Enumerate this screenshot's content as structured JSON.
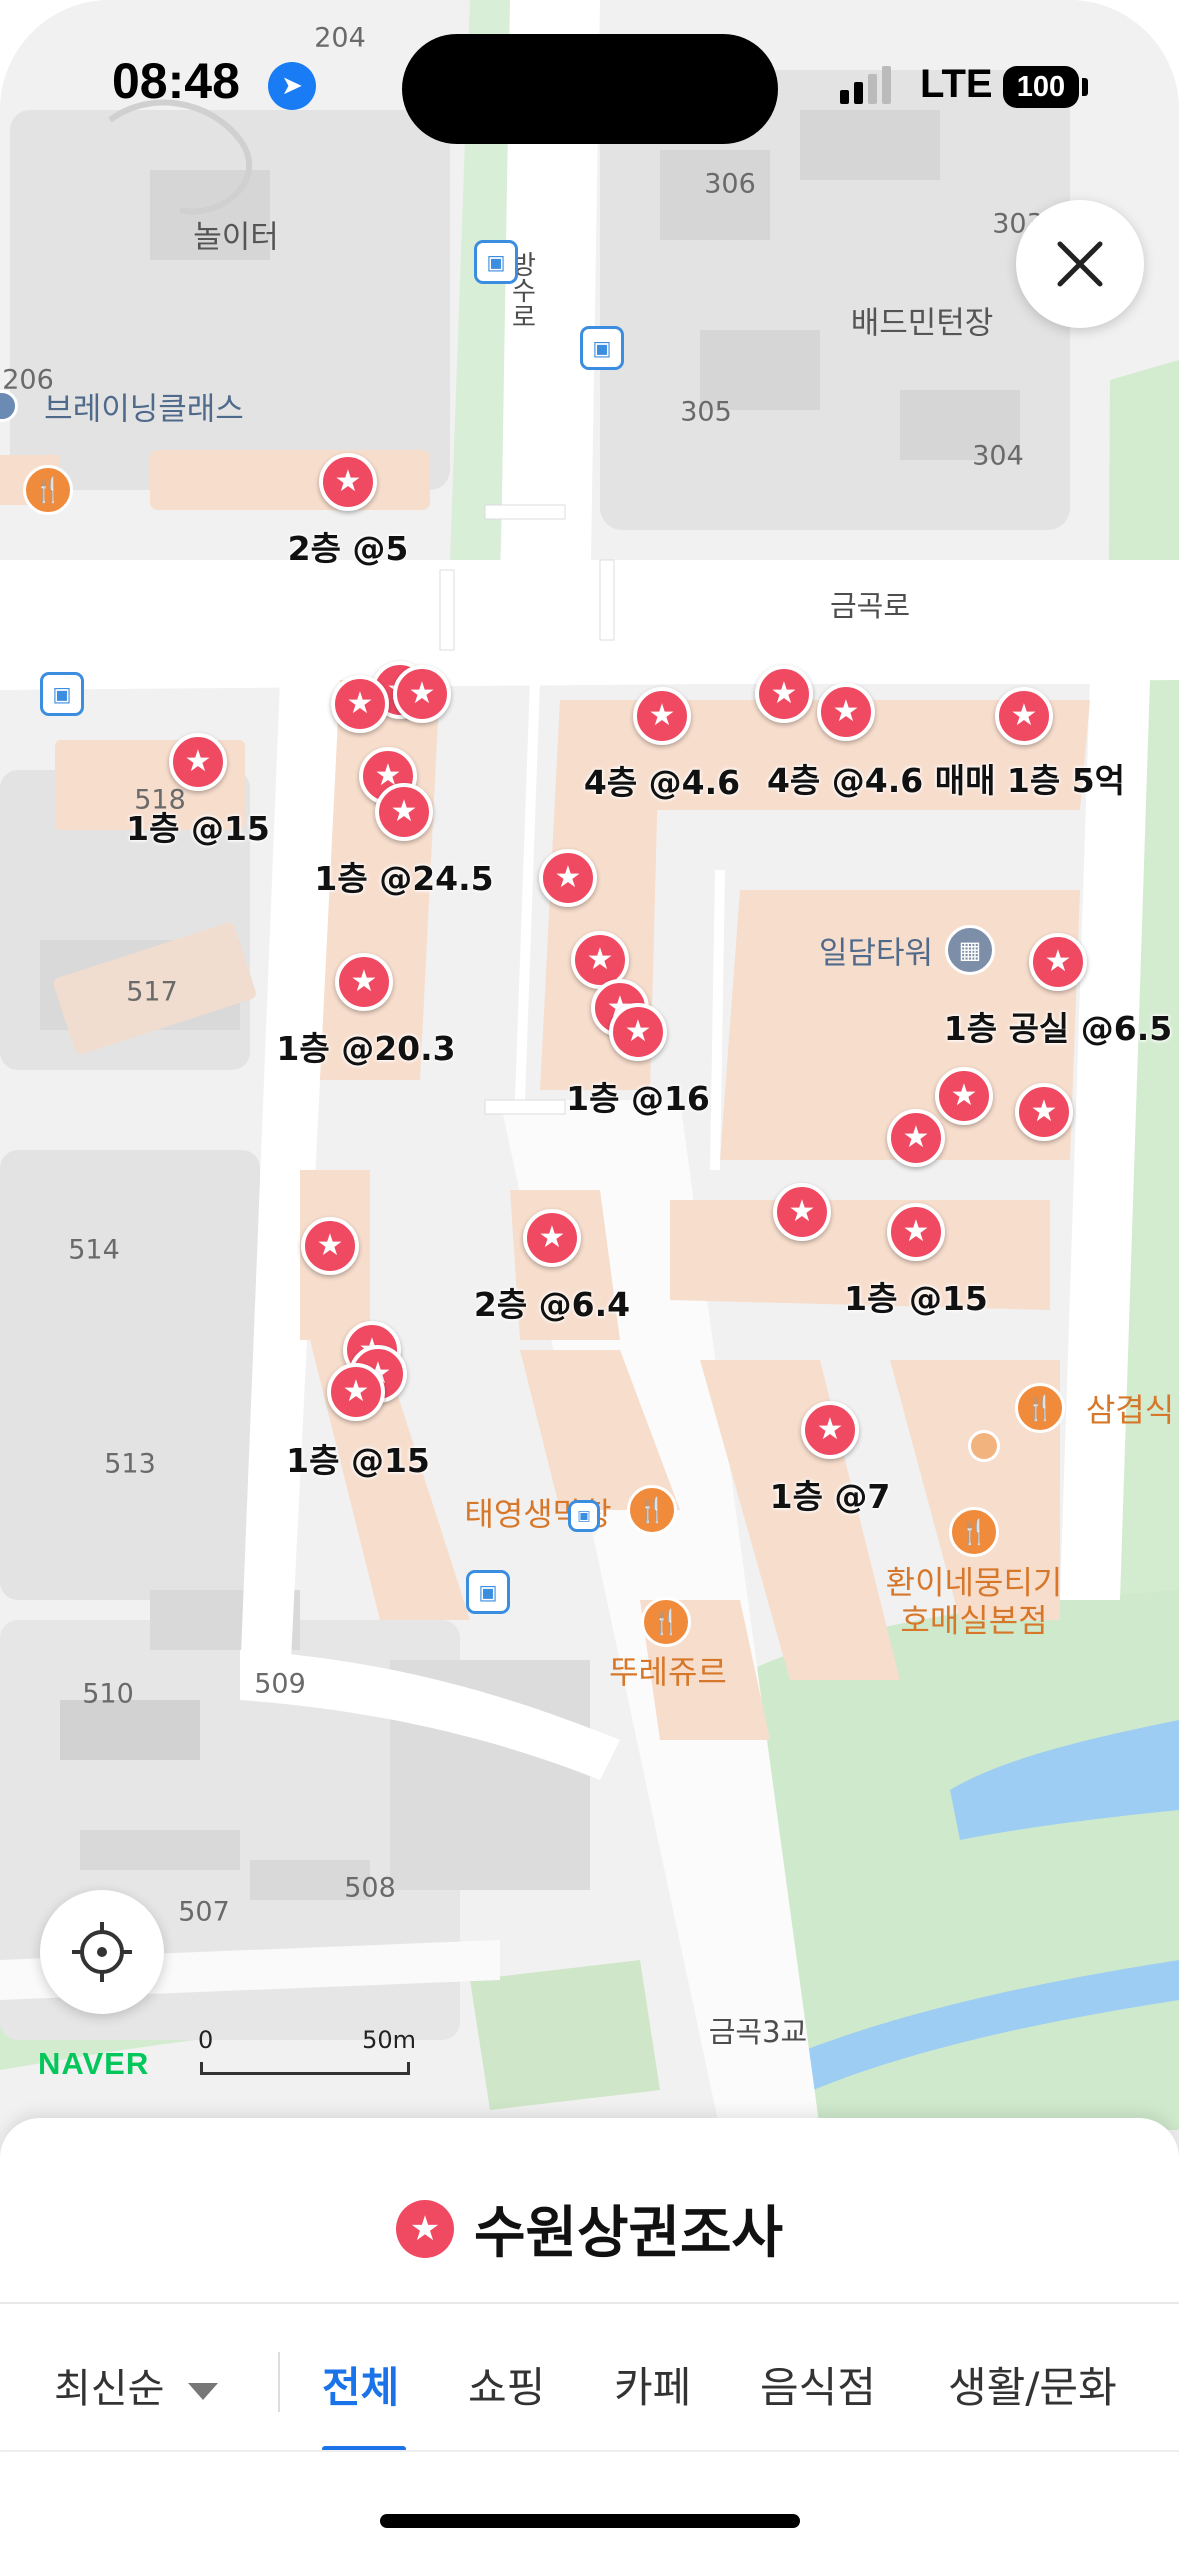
{
  "status_bar": {
    "time": "08:48",
    "network": "LTE",
    "battery": "100"
  },
  "map": {
    "block_numbers": [
      "204",
      "306",
      "303",
      "305",
      "304",
      "206",
      "518",
      "517",
      "514",
      "513",
      "510",
      "509",
      "507",
      "508"
    ],
    "places": [
      "놀이터",
      "배드민턴장",
      "브레이닝클래스",
      "일담타워"
    ],
    "roads": [
      "금곡로",
      "금곡3교",
      "방수로"
    ],
    "restaurants": [
      "태영생막창",
      "뚜레쥬르",
      "삼겹식",
      "환이네뭉티기\n호매실본점"
    ],
    "listing_labels": [
      "2층 @5",
      "1층 @15",
      "1층 @24.5",
      "1층 @20.3",
      "4층 @4.6",
      "4층 @4.6 매매 1층 5억",
      "1층 공실 @6.5",
      "1층 @16",
      "2층 @6.4",
      "1층 @15",
      "1층 @15",
      "1층 @7"
    ],
    "scale": {
      "zero": "0",
      "distance": "50m"
    },
    "logo": "NAVER"
  },
  "sheet": {
    "title": "수원상권조사",
    "sort": "최신순",
    "tabs": [
      "전체",
      "쇼핑",
      "카페",
      "음식점",
      "생활/문화"
    ],
    "active_tab": "전체"
  },
  "colors": {
    "pin": "#f04a63",
    "accent": "#1a73e8",
    "poi": "#f08b3c",
    "park": "#d3ecd0",
    "water": "#9dcdf3"
  },
  "icons": [
    "location-arrow-icon",
    "close-icon",
    "crosshair-icon",
    "star-icon",
    "fork-knife-icon",
    "bus-stop-icon",
    "building-icon",
    "chevron-down-icon"
  ]
}
